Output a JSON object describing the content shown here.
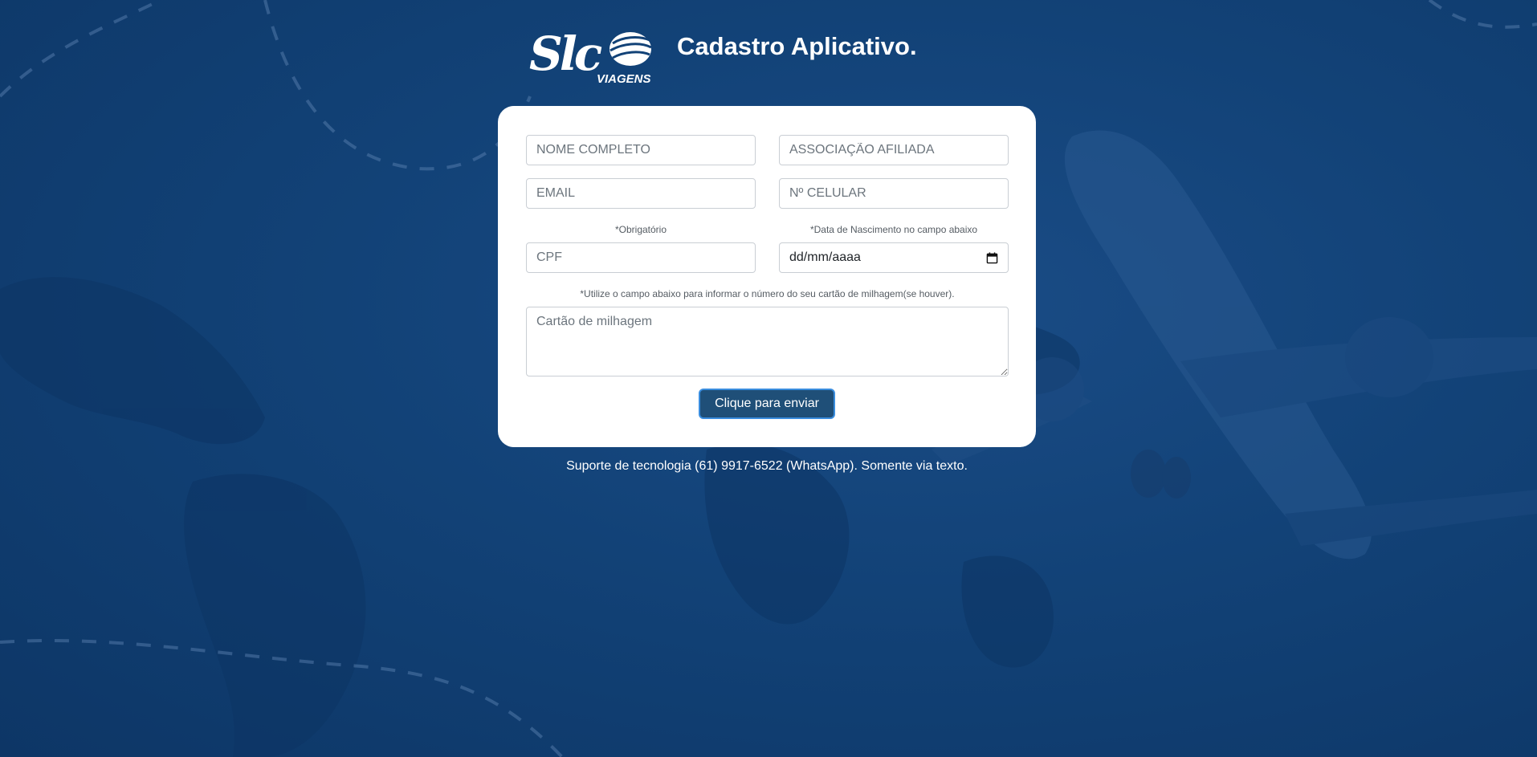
{
  "header": {
    "logo_main": "Slc",
    "logo_sub": "VIAGENS",
    "title": "Cadastro Aplicativo."
  },
  "form": {
    "nome_placeholder": "NOME COMPLETO",
    "associacao_placeholder": "ASSOCIAÇÃO AFILIADA",
    "email_placeholder": "EMAIL",
    "celular_placeholder": "Nº CELULAR",
    "cpf_hint": "*Obrigatório",
    "cpf_placeholder": "CPF",
    "date_hint": "*Data de Nascimento no campo abaixo",
    "date_placeholder": "dd/mm/aaaa",
    "milhagem_hint": "*Utilize o campo abaixo para informar o número do seu cartão de milhagem(se houver).",
    "milhagem_placeholder": "Cartão de milhagem",
    "submit_label": "Clique para enviar"
  },
  "footer": {
    "support_text": "Suporte de tecnologia (61) 9917-6522 (WhatsApp). Somente via texto."
  },
  "icons": {
    "date": "calendar-icon",
    "logo": "logo-icon"
  },
  "colors": {
    "background": "#124277",
    "button": "#1f4f78",
    "button_border": "#3a8dde"
  }
}
